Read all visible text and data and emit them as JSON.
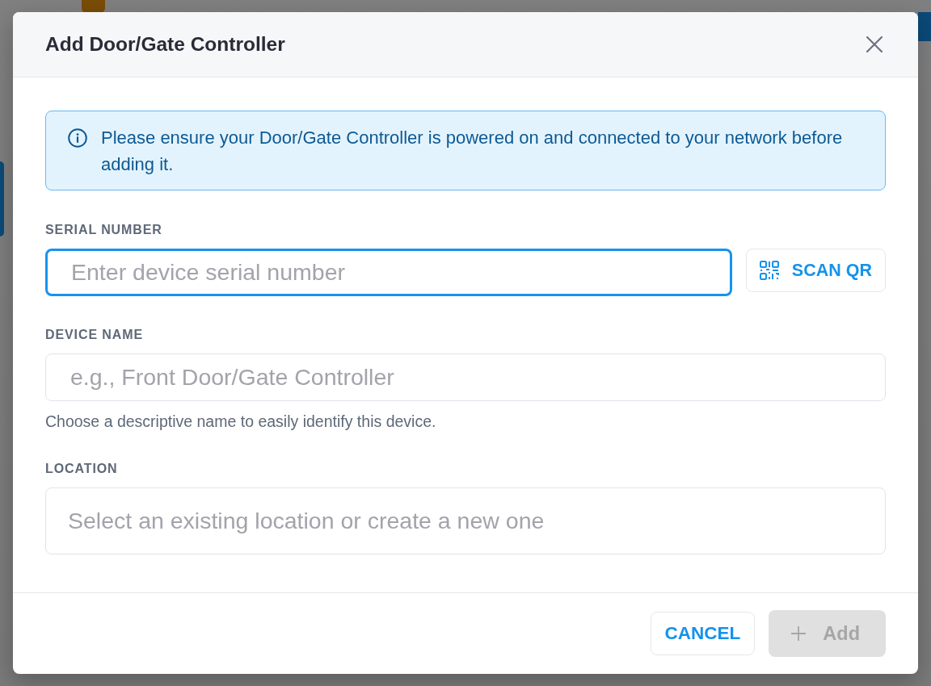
{
  "dialog": {
    "title": "Add Door/Gate Controller"
  },
  "notice": {
    "text": "Please ensure your Door/Gate Controller is powered on and connected to your network before adding it."
  },
  "fields": [
    {
      "kind": "text",
      "label": "SERIAL NUMBER",
      "placeholder": "Enter device serial number",
      "focused": true,
      "action": {
        "label": "SCAN QR"
      }
    },
    {
      "kind": "text",
      "label": "DEVICE NAME",
      "placeholder": "e.g., Front Door/Gate Controller",
      "focused": false,
      "hint": "Choose a descriptive name to easily identify this device."
    },
    {
      "kind": "combobox",
      "label": "LOCATION",
      "placeholder": "Select an existing location or create a new one",
      "focused": false
    }
  ],
  "buttons": [
    {
      "kind": "outline",
      "label": "CANCEL",
      "disabled": false
    },
    {
      "kind": "add",
      "label": "Add",
      "disabled": true
    }
  ]
}
